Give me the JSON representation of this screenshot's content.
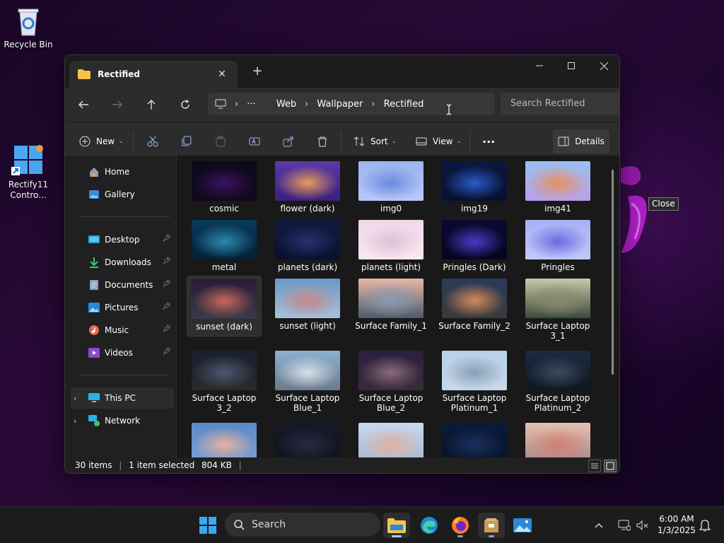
{
  "desktop": {
    "icons": [
      {
        "label": "Recycle Bin"
      },
      {
        "label": "Rectify11 Contro..."
      }
    ]
  },
  "window": {
    "tab_title": "Rectified",
    "new_tab_symbol": "+",
    "controls": {
      "minimize": "—",
      "maximize": "☐",
      "close": "✕"
    },
    "breadcrumb": [
      "Web",
      "Wallpaper",
      "Rectified"
    ],
    "breadcrumb_overflow": "···",
    "search_placeholder": "Search Rectified",
    "commands": {
      "new": "New",
      "sort": "Sort",
      "view": "View",
      "more": "···",
      "details": "Details"
    },
    "nav": {
      "top": [
        {
          "label": "Home"
        },
        {
          "label": "Gallery"
        }
      ],
      "quick": [
        {
          "label": "Desktop",
          "pinned": true
        },
        {
          "label": "Downloads",
          "pinned": true
        },
        {
          "label": "Documents",
          "pinned": true
        },
        {
          "label": "Pictures",
          "pinned": true
        },
        {
          "label": "Music",
          "pinned": true
        },
        {
          "label": "Videos",
          "pinned": true
        }
      ],
      "bottom": [
        {
          "label": "This PC"
        },
        {
          "label": "Network"
        }
      ]
    },
    "files": [
      {
        "name": "cosmic",
        "colors": [
          "#0c0a18",
          "#3a1260",
          "#12081e"
        ]
      },
      {
        "name": "flower (dark)",
        "colors": [
          "#5a3aa8",
          "#e89a5a",
          "#3a1f7a"
        ]
      },
      {
        "name": "img0",
        "colors": [
          "#9ab4f0",
          "#6a8ae0",
          "#b8c8f8"
        ]
      },
      {
        "name": "img19",
        "colors": [
          "#0a1840",
          "#2a5ac8",
          "#081030"
        ]
      },
      {
        "name": "img41",
        "colors": [
          "#9ac0f0",
          "#e89060",
          "#b8a0e8"
        ]
      },
      {
        "name": "metal",
        "colors": [
          "#0a3a5a",
          "#2a8ab0",
          "#062034"
        ]
      },
      {
        "name": "planets (dark)",
        "colors": [
          "#101a40",
          "#2a3070",
          "#0a1030"
        ]
      },
      {
        "name": "planets (light)",
        "colors": [
          "#f0d8e8",
          "#e0c0d8",
          "#f8e8f0"
        ]
      },
      {
        "name": "Pringles (Dark)",
        "colors": [
          "#0a0a30",
          "#4a3ac8",
          "#050520"
        ]
      },
      {
        "name": "Pringles",
        "colors": [
          "#a8b0f8",
          "#6a6ae0",
          "#c0c8f8"
        ]
      },
      {
        "name": "sunset (dark)",
        "colors": [
          "#2a1a3a",
          "#c86858",
          "#3a3a4a"
        ]
      },
      {
        "name": "sunset (light)",
        "colors": [
          "#6a9ac8",
          "#c88888",
          "#a8c0d8"
        ]
      },
      {
        "name": "Surface Family_1",
        "colors": [
          "#e8b8a8",
          "#8a9ab0",
          "#4a5a6a"
        ]
      },
      {
        "name": "Surface Family_2",
        "colors": [
          "#2a3a5a",
          "#d88a5a",
          "#3a3a3a"
        ]
      },
      {
        "name": "Surface Laptop 3_1",
        "colors": [
          "#c8c8a8",
          "#8a8a6a",
          "#3a4a3a"
        ]
      },
      {
        "name": "Surface Laptop 3_2",
        "colors": [
          "#1a2030",
          "#4a5870",
          "#2a2a2a"
        ]
      },
      {
        "name": "Surface Laptop Blue_1",
        "colors": [
          "#8ab0d0",
          "#d8e0e8",
          "#6a7a8a"
        ]
      },
      {
        "name": "Surface Laptop Blue_2",
        "colors": [
          "#2a2040",
          "#8a6a7a",
          "#3a2a3a"
        ]
      },
      {
        "name": "Surface Laptop Platinum_1",
        "colors": [
          "#b8d0e8",
          "#8aa0b8",
          "#c8d8e8"
        ]
      },
      {
        "name": "Surface Laptop Platinum_2",
        "colors": [
          "#1a2a40",
          "#3a4a60",
          "#101820"
        ]
      },
      {
        "name": "",
        "colors": [
          "#5a8ac8",
          "#e8b0a0",
          "#7aa0d0"
        ]
      },
      {
        "name": "",
        "colors": [
          "#141828",
          "#2a2a40",
          "#101420"
        ]
      },
      {
        "name": "",
        "colors": [
          "#c8d8f0",
          "#e0b0a0",
          "#a8b8d0"
        ]
      },
      {
        "name": "",
        "colors": [
          "#0a1a3a",
          "#1a3060",
          "#081428"
        ]
      },
      {
        "name": "",
        "colors": [
          "#e8c0b0",
          "#d08070",
          "#a88888"
        ]
      }
    ],
    "selected_file": "sunset (dark)",
    "status": {
      "items": "30 items",
      "selected": "1 item selected",
      "size": "804 KB"
    }
  },
  "tooltip": "Close",
  "taskbar": {
    "search_label": "Search",
    "time": "6:00 AM",
    "date": "1/3/2025"
  }
}
